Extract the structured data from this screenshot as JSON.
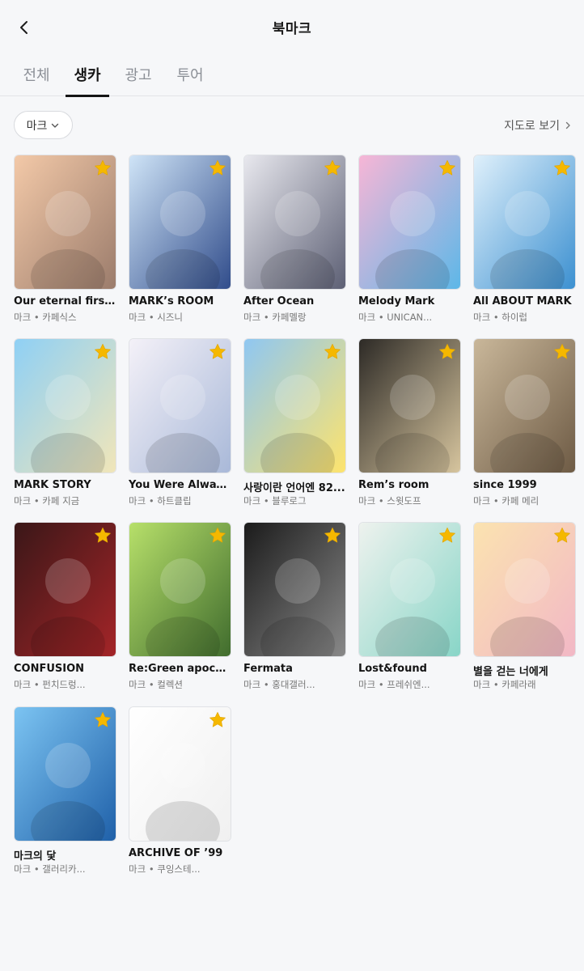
{
  "header": {
    "title": "북마크"
  },
  "tabs": [
    {
      "label": "전체"
    },
    {
      "label": "생카"
    },
    {
      "label": "광고"
    },
    {
      "label": "투어"
    }
  ],
  "active_tab": "생카",
  "filter": {
    "label": "마크"
  },
  "map_link": {
    "label": "지도로 보기"
  },
  "colors": {
    "accent": "#151515",
    "star": "#f5b800",
    "muted": "#8b8f96"
  },
  "cards": [
    {
      "title": "Our eternal first l...",
      "subtitle": "마크 • 카페식스",
      "bg": [
        "#f3c9a8",
        "#9a7b6b"
      ]
    },
    {
      "title": "MARK’s ROOM",
      "subtitle": "마크 • 시즈니",
      "bg": [
        "#cfe4f7",
        "#2f4b8a"
      ]
    },
    {
      "title": "After Ocean",
      "subtitle": "마크 • 카페멜랑",
      "bg": [
        "#e8e8ee",
        "#5b5e73"
      ]
    },
    {
      "title": "Melody Mark",
      "subtitle": "마크 • UNICAN...",
      "bg": [
        "#f7b6d6",
        "#5bb7e8"
      ]
    },
    {
      "title": "All ABOUT MARK",
      "subtitle": "마크 • 하이럽",
      "bg": [
        "#dff0fb",
        "#3a8fd0"
      ]
    },
    {
      "title": "MARK STORY",
      "subtitle": "마크 • 카페 지금",
      "bg": [
        "#8fd0f5",
        "#f2e6b8"
      ]
    },
    {
      "title": "You Were Always ...",
      "subtitle": "마크 • 하트클립",
      "bg": [
        "#f4f1f8",
        "#a8b8d8"
      ]
    },
    {
      "title": "사랑이란 언어엔 82...",
      "subtitle": "마크 • 블루로그",
      "bg": [
        "#8fc7f2",
        "#ffe46b"
      ]
    },
    {
      "title": "Rem’s room",
      "subtitle": "마크 • 스윗도프",
      "bg": [
        "#2d2a26",
        "#d9c7a0"
      ]
    },
    {
      "title": "since 1999",
      "subtitle": "마크 • 카페 메리",
      "bg": [
        "#c9b79a",
        "#6d5a44"
      ]
    },
    {
      "title": "CONFUSION",
      "subtitle": "마크 • 펀치드렁...",
      "bg": [
        "#3a1718",
        "#a52528"
      ]
    },
    {
      "title": "Re:Green apocaly...",
      "subtitle": "마크 • 컬렉션",
      "bg": [
        "#b7e06a",
        "#3f6b2d"
      ]
    },
    {
      "title": "Fermata",
      "subtitle": "마크 • 홍대갤러...",
      "bg": [
        "#1b1b1b",
        "#8a8a8a"
      ]
    },
    {
      "title": "Lost&found",
      "subtitle": "마크 • 프레쉬엔...",
      "bg": [
        "#eef2ee",
        "#87d5c7"
      ]
    },
    {
      "title": "별을 걷는 너에게",
      "subtitle": "마크 • 카페라래",
      "bg": [
        "#fbe3b0",
        "#f2b7c6"
      ]
    },
    {
      "title": "마크의 닻",
      "subtitle": "마크 • 갤러리카...",
      "bg": [
        "#7cc4f2",
        "#1e5fa8"
      ]
    },
    {
      "title": "ARCHIVE OF ’99",
      "subtitle": "마크 • 쿠잉스테...",
      "bg": [
        "#ffffff",
        "#f0f0f0"
      ]
    }
  ]
}
